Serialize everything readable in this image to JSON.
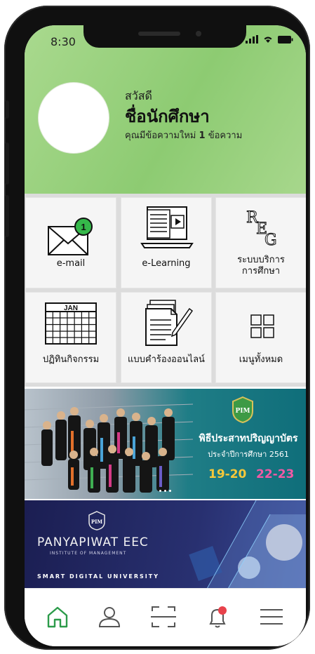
{
  "status_bar": {
    "time": "8:30"
  },
  "profile": {
    "greeting": "สวัสดี",
    "name": "ชื่อนักศึกษา",
    "message_prefix": "คุณมีข้อความใหม่",
    "message_count": "1",
    "message_suffix": "ข้อความ"
  },
  "menu": {
    "email": {
      "label": "e-mail",
      "badge": "1"
    },
    "elearning": {
      "label": "e-Learning"
    },
    "reg": {
      "label_line1": "ระบบบริการ",
      "label_line2": "การศึกษา",
      "icon_letters": [
        "R",
        "E",
        "G"
      ]
    },
    "calendar": {
      "label": "ปฏิทินกิจกรรม",
      "month": "JAN"
    },
    "online_form": {
      "label": "แบบคำร้องออนไลน์"
    },
    "all_menu": {
      "label": "เมนูทั้งหมด"
    }
  },
  "banner_graduation": {
    "logo": "PIM",
    "title": "พิธีประสาทปริญญาบัตร",
    "subtitle": "ประจำปีการศึกษา 2561",
    "date1": "19-20",
    "date2": "22-23"
  },
  "banner_eec": {
    "logo": "PIM",
    "title": "PANYAPIWAT EEC",
    "institute": "INSTITUTE OF MANAGEMENT",
    "tagline": "SMART DIGITAL UNIVERSITY"
  },
  "colors": {
    "accent": "#2c9b4a",
    "badge": "#35b84a",
    "notification": "#e8424b",
    "hero": "#98d17e"
  }
}
